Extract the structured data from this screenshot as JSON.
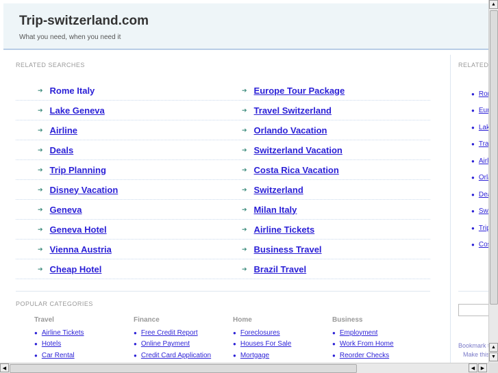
{
  "header": {
    "title": "Trip-switzerland.com",
    "tagline": "What you need, when you need it"
  },
  "related": {
    "label": "RELATED SEARCHES",
    "rows": [
      [
        "Rome Italy",
        "Europe Tour Package"
      ],
      [
        "Lake Geneva",
        "Travel Switzerland"
      ],
      [
        "Airline",
        "Orlando Vacation"
      ],
      [
        "Deals",
        "Switzerland Vacation"
      ],
      [
        "Trip Planning",
        "Costa Rica Vacation"
      ],
      [
        "Disney Vacation",
        "Switzerland"
      ],
      [
        "Geneva",
        "Milan Italy"
      ],
      [
        "Geneva Hotel",
        "Airline Tickets"
      ],
      [
        "Vienna Austria",
        "Business Travel"
      ],
      [
        "Cheap Hotel",
        "Brazil Travel"
      ]
    ]
  },
  "popular": {
    "label": "POPULAR CATEGORIES",
    "categories": [
      {
        "title": "Travel",
        "items": [
          "Airline Tickets",
          "Hotels",
          "Car Rental"
        ]
      },
      {
        "title": "Finance",
        "items": [
          "Free Credit Report",
          "Online Payment",
          "Credit Card Application"
        ]
      },
      {
        "title": "Home",
        "items": [
          "Foreclosures",
          "Houses For Sale",
          "Mortgage"
        ]
      },
      {
        "title": "Business",
        "items": [
          "Employment",
          "Work From Home",
          "Reorder Checks"
        ]
      }
    ]
  },
  "sidebar": {
    "label": "RELATED",
    "items": [
      "Rome Italy",
      "Europe Tour Package",
      "Lake Geneva",
      "Travel Switzerland",
      "Airline",
      "Orlando Vacation",
      "Deals",
      "Switzerland Vacation",
      "Trip Planning",
      "Costa Rica Vacation"
    ],
    "bookmark": "Bookmark this page",
    "homepage": "Make this your homepage"
  },
  "colors": {
    "link": "#2a1fd6",
    "header_bg": "#eef5f8",
    "arrow": "#3a8a7a"
  }
}
